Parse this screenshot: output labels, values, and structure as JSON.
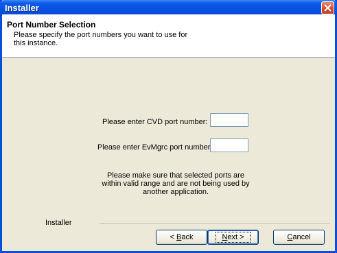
{
  "window": {
    "title": "Installer"
  },
  "header": {
    "title": "Port Number Selection",
    "subtitle": "Please specify the port numbers you want to use for this instance."
  },
  "form": {
    "cvd_label": "Please enter CVD port number:",
    "cvd_value": "",
    "evmgrc_label": "Please enter EvMgrc port number:",
    "evmgrc_value": "",
    "note": "Please make sure that selected ports are within valid range and are not being used by another application."
  },
  "footer": {
    "group_label": "Installer",
    "back_prefix": "< ",
    "back_mnemonic": "B",
    "back_rest": "ack",
    "next_mnemonic": "N",
    "next_rest": "ext >",
    "cancel_mnemonic": "C",
    "cancel_rest": "ancel"
  },
  "icons": {
    "close": "close-icon"
  },
  "colors": {
    "titlebar": "#0a4fd6",
    "close_button": "#d44a24",
    "dialog_bg": "#ece9d8"
  }
}
